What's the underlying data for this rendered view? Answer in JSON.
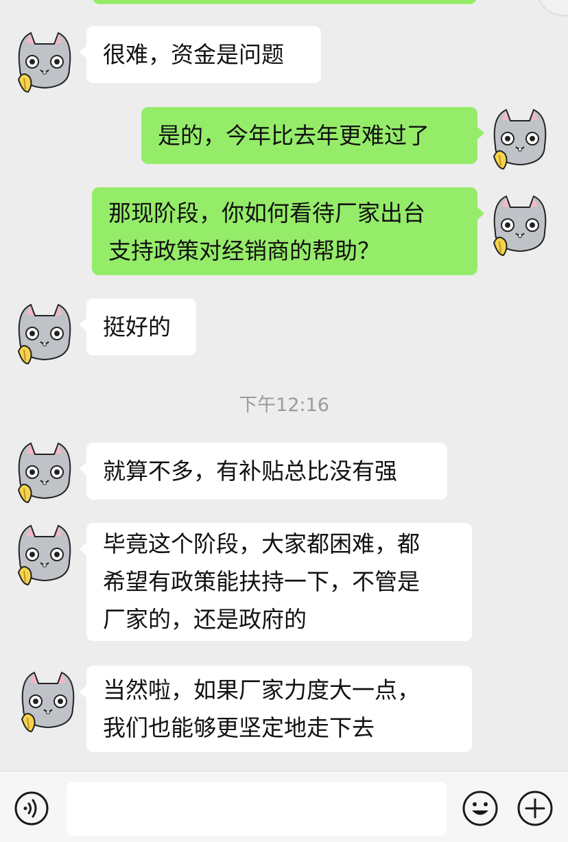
{
  "chat": {
    "messages": [
      {
        "side": "left",
        "text": "很难，资金是问题"
      },
      {
        "side": "right",
        "text": "是的，今年比去年更难过了"
      },
      {
        "side": "right",
        "text": "那现阶段，你如何看待厂家出台\n支持政策对经销商的帮助？"
      },
      {
        "side": "left",
        "text": "挺好的"
      },
      {
        "side": "left",
        "text": "就算不多，有补贴总比没有强"
      },
      {
        "side": "left",
        "text": "毕竟这个阶段，大家都困难，都\n希望有政策能扶持一下，不管是\n厂家的，还是政府的"
      },
      {
        "side": "left",
        "text": "当然啦，如果厂家力度大一点，\n我们也能够更坚定地走下去"
      }
    ],
    "timestamp": "下午12:16"
  },
  "avatar_icon": "gray-cat-with-banana",
  "input_bar": {
    "voice_icon": "voice-icon",
    "input_value": "",
    "emoji_icon": "emoji-icon",
    "plus_icon": "plus-icon"
  },
  "colors": {
    "background": "#ededed",
    "outgoing_bubble": "#95ec69",
    "incoming_bubble": "#ffffff",
    "timestamp_text": "#9b9b9b"
  }
}
